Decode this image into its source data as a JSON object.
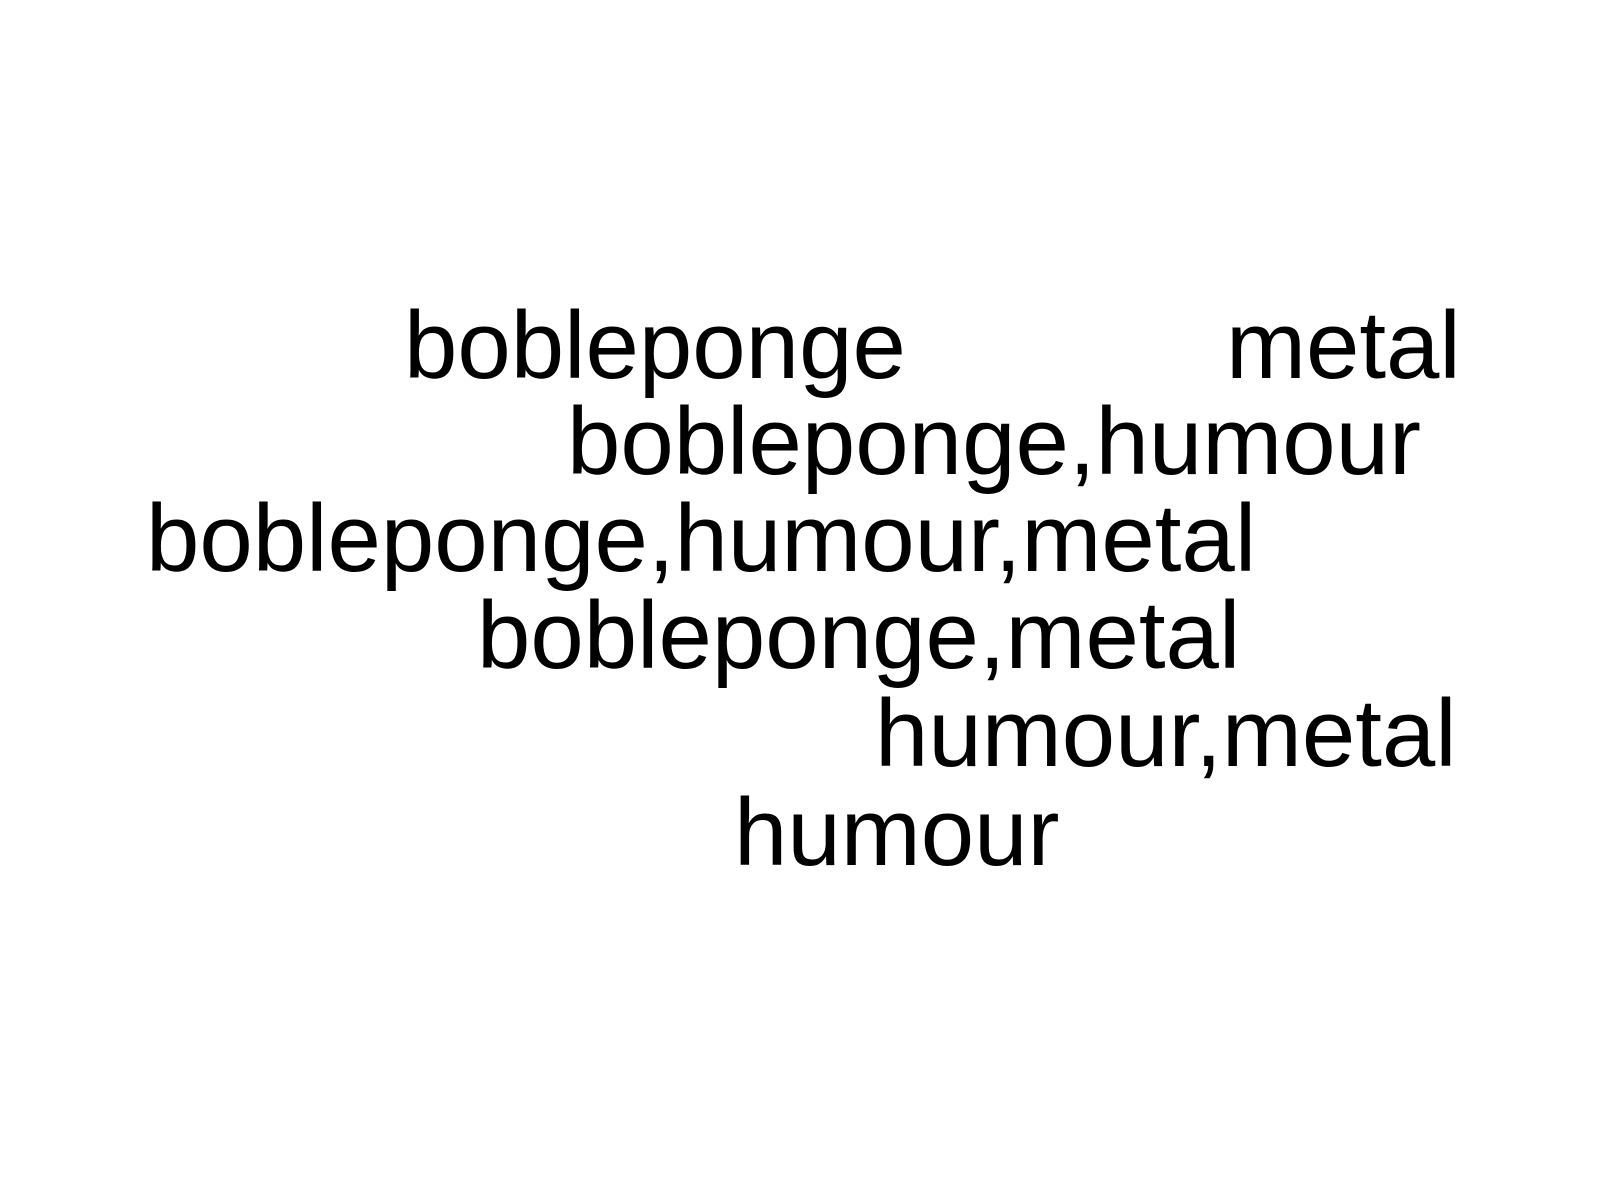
{
  "words": [
    {
      "text": "bobleponge"
    },
    {
      "text": "metal"
    },
    {
      "text": "bobleponge,humour"
    },
    {
      "text": "bobleponge,humour,metal"
    },
    {
      "text": "bobleponge,metal"
    },
    {
      "text": "humour,metal"
    },
    {
      "text": "humour"
    }
  ],
  "colors": {
    "background": "#ffffff",
    "text": "#000000"
  }
}
